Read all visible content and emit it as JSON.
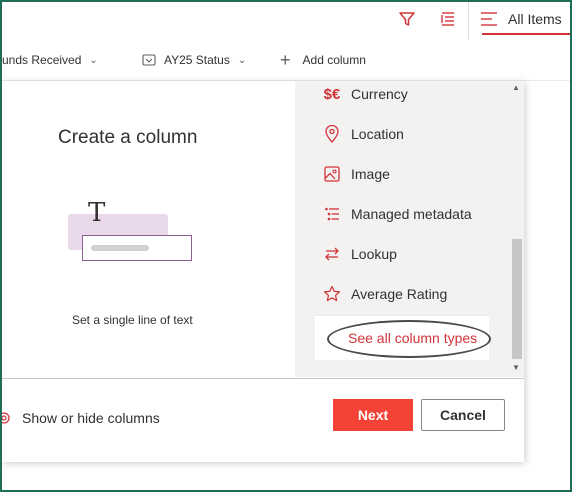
{
  "toolbar": {
    "filter_icon": "filter-icon",
    "grouping_icon": "grouping-icon",
    "view_label": "All Items"
  },
  "columns": {
    "funds_received": "unds Received",
    "ay25_status": "AY25 Status",
    "add_column": "Add column"
  },
  "panel": {
    "title": "Create a column",
    "caption": "Set a single line of text",
    "column_types": [
      {
        "label": "Currency",
        "icon": "currency-icon"
      },
      {
        "label": "Location",
        "icon": "location-icon"
      },
      {
        "label": "Image",
        "icon": "image-icon"
      },
      {
        "label": "Managed metadata",
        "icon": "managed-metadata-icon"
      },
      {
        "label": "Lookup",
        "icon": "lookup-icon"
      },
      {
        "label": "Average Rating",
        "icon": "star-icon"
      }
    ],
    "see_all": "See all column types",
    "show_hide": "Show or hide columns",
    "next_label": "Next",
    "cancel_label": "Cancel"
  },
  "colors": {
    "accent": "#d13438",
    "primary_button": "#f44336",
    "frame": "#1e6e5a"
  }
}
